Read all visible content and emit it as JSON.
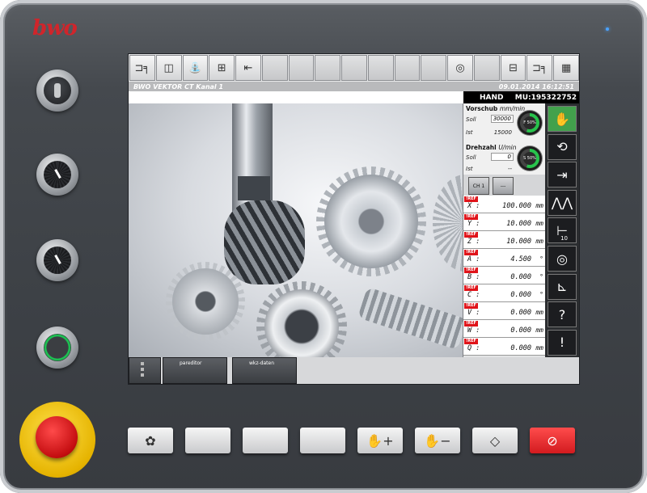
{
  "brand": {
    "logo_text": "bwo",
    "accent": "#d0252b"
  },
  "toolbar": {
    "buttons": [
      {
        "icon": "axis-zero-icon",
        "glyph": "⊐╕"
      },
      {
        "icon": "document-icon",
        "glyph": "◫"
      },
      {
        "icon": "coolant-tap-icon",
        "glyph": "⛲"
      },
      {
        "icon": "spindle-icon",
        "glyph": "⊞"
      },
      {
        "icon": "tool-offset-icon",
        "glyph": "⇤"
      },
      {
        "icon": "empty",
        "glyph": ""
      },
      {
        "icon": "empty",
        "glyph": ""
      },
      {
        "icon": "empty",
        "glyph": ""
      },
      {
        "icon": "empty",
        "glyph": ""
      },
      {
        "icon": "empty",
        "glyph": ""
      },
      {
        "icon": "empty",
        "glyph": ""
      },
      {
        "icon": "empty",
        "glyph": ""
      },
      {
        "icon": "gauge-dial-icon",
        "glyph": "◎"
      },
      {
        "icon": "empty",
        "glyph": ""
      },
      {
        "icon": "spindle-clamp-icon",
        "glyph": "⊟"
      },
      {
        "icon": "axis-zero-2-icon",
        "glyph": "⊐╕"
      },
      {
        "icon": "keyboard-icon",
        "glyph": "▦"
      }
    ]
  },
  "status": {
    "title": "BWO VEKTOR CT  Kanal 1",
    "datetime": "09.01.2014 16:12:51"
  },
  "modebar": {
    "mode": "HAND",
    "mu": "MU:195322752"
  },
  "feed": {
    "heading": "Vorschub",
    "unit": "mm/min",
    "soll_label": "Soll",
    "soll_value": "30000",
    "ist_label": "Ist",
    "ist_value": "15000",
    "gauge_label": "F 50%",
    "gauge_percent": 50
  },
  "spindle": {
    "heading": "Drehzahl",
    "unit": "U/min",
    "soll_label": "Soll",
    "soll_value": "0",
    "ist_label": "Ist",
    "ist_value": "--",
    "gauge_label": "S 50%",
    "gauge_percent": 50
  },
  "channel": {
    "ch_label": "CH 1",
    "more_label": "---"
  },
  "axes": [
    {
      "ref": "!REF",
      "name": "X :",
      "value": "100.000",
      "unit": "mm"
    },
    {
      "ref": "!REF",
      "name": "Y :",
      "value": "10.000",
      "unit": "mm"
    },
    {
      "ref": "!REF",
      "name": "Z :",
      "value": "10.000",
      "unit": "mm"
    },
    {
      "ref": "!REF",
      "name": "A :",
      "value": "4.500",
      "unit": "°"
    },
    {
      "ref": "!REF",
      "name": "B :",
      "value": "0.000",
      "unit": "°"
    },
    {
      "ref": "!REF",
      "name": "C :",
      "value": "0.000",
      "unit": "°"
    },
    {
      "ref": "!REF",
      "name": "V :",
      "value": "0.000",
      "unit": "mm"
    },
    {
      "ref": "!REF",
      "name": "W :",
      "value": "0.000",
      "unit": "mm"
    },
    {
      "ref": "!REF",
      "name": "Q :",
      "value": "0.000",
      "unit": "mm"
    }
  ],
  "side_buttons": [
    {
      "icon": "hand-mode-icon",
      "glyph": "✋",
      "label": ""
    },
    {
      "icon": "cycle-icon",
      "glyph": "⟲",
      "label": ""
    },
    {
      "icon": "jog-to-stop-icon",
      "glyph": "⇥",
      "label": ""
    },
    {
      "icon": "zigzag-icon",
      "glyph": "⋀⋀",
      "label": ""
    },
    {
      "icon": "increment-icon",
      "glyph": "⊢",
      "label": "10"
    },
    {
      "icon": "tool-circle-icon",
      "glyph": "◎",
      "label": ""
    },
    {
      "icon": "reference-point-icon",
      "glyph": "⊾",
      "label": ""
    },
    {
      "icon": "help-icon",
      "glyph": "?",
      "label": ""
    },
    {
      "icon": "alarm-icon",
      "glyph": "!",
      "label": ""
    }
  ],
  "softkeys": [
    {
      "label": ""
    },
    {
      "label": "pareditor"
    },
    {
      "label": "wkz-daten"
    }
  ],
  "hardware_keys": [
    {
      "icon": "fan-icon",
      "glyph": "✿"
    },
    {
      "icon": "blank-icon",
      "glyph": ""
    },
    {
      "icon": "blank-icon",
      "glyph": ""
    },
    {
      "icon": "blank-icon",
      "glyph": ""
    },
    {
      "icon": "hand-plus-icon",
      "glyph": "✋+"
    },
    {
      "icon": "hand-minus-icon",
      "glyph": "✋−"
    },
    {
      "icon": "cycle-start-icon",
      "glyph": "◇"
    },
    {
      "icon": "cycle-stop-icon",
      "glyph": "⊘"
    }
  ]
}
